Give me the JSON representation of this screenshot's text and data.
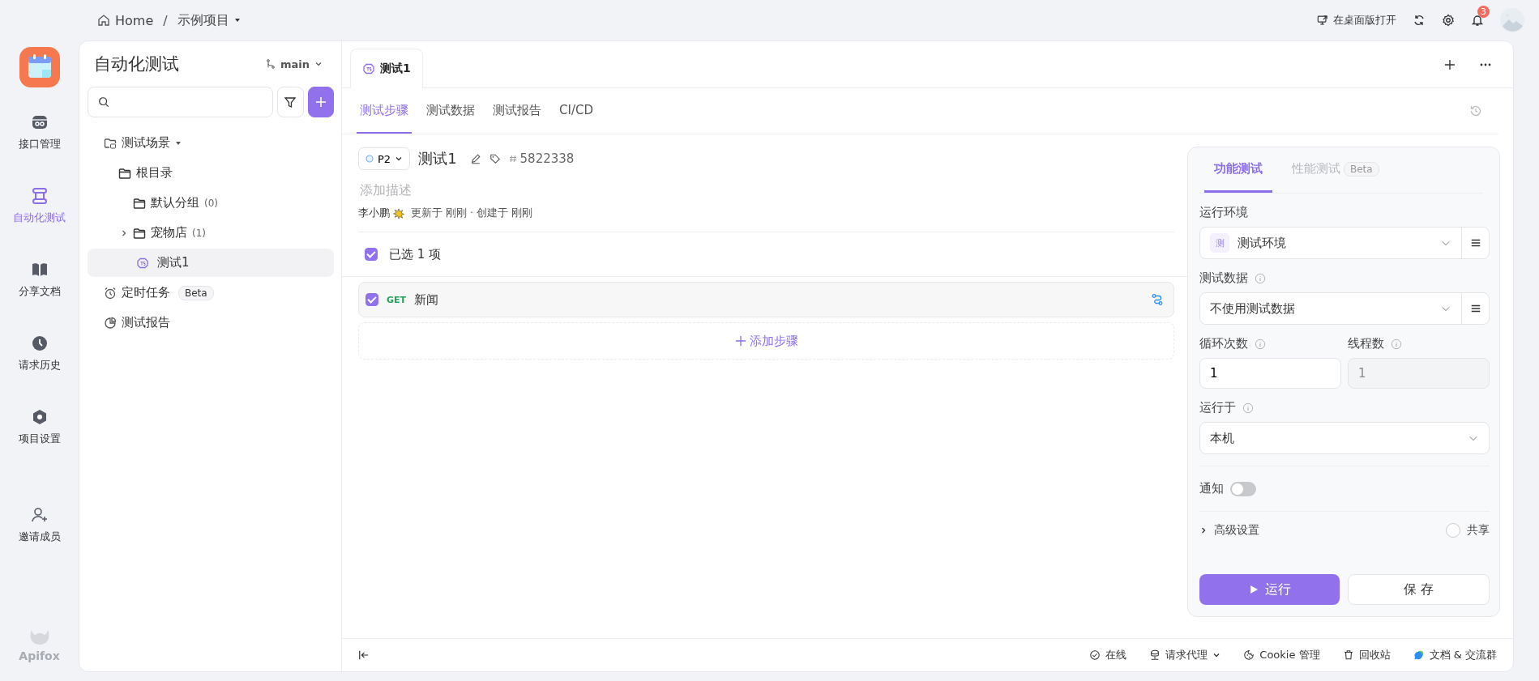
{
  "breadcrumb": {
    "home": "Home",
    "separator": "/",
    "project": "示例项目"
  },
  "toolbar": {
    "open_desktop": "在桌面版打开",
    "notifications": "3"
  },
  "rail": {
    "items": [
      {
        "label": "接口管理",
        "kind": "api",
        "selected": false
      },
      {
        "label": "自动化测试",
        "kind": "auto",
        "selected": true
      },
      {
        "label": "分享文档",
        "kind": "book",
        "selected": false
      },
      {
        "label": "请求历史",
        "kind": "clock",
        "selected": false
      },
      {
        "label": "项目设置",
        "kind": "hex",
        "selected": false
      }
    ],
    "invite": "邀请成员",
    "brand": "Apifox"
  },
  "sidebar": {
    "title": "自动化测试",
    "branch": "main",
    "tree": [
      {
        "label": "测试场景",
        "kind": "scenes",
        "expanded": true,
        "selected": false,
        "children": [
          {
            "label": "根目录",
            "kind": "folder",
            "selected": false,
            "children": [
              {
                "label": "默认分组",
                "count": "(0)",
                "kind": "folder",
                "selected": false
              },
              {
                "label": "宠物店",
                "count": "(1)",
                "kind": "folder",
                "expanded": false,
                "selected": false
              },
              {
                "label": "测试1",
                "kind": "test",
                "selected": true
              }
            ]
          }
        ]
      },
      {
        "label": "定时任务",
        "badge": "Beta",
        "kind": "alarm",
        "selected": false
      },
      {
        "label": "测试报告",
        "kind": "report",
        "selected": false
      }
    ]
  },
  "tabs": [
    {
      "label": "测试1",
      "selected": true
    }
  ],
  "subtabs": [
    {
      "label": "测试步骤",
      "selected": true
    },
    {
      "label": "测试数据",
      "selected": false
    },
    {
      "label": "测试报告",
      "selected": false
    },
    {
      "label": "CI/CD",
      "selected": false
    }
  ],
  "scenario": {
    "priority": "P2",
    "name": "测试1",
    "id": "5822338",
    "description_placeholder": "添加描述",
    "author": "李小鹏",
    "meta": "更新于 刚刚 · 创建于 刚刚"
  },
  "selection": {
    "label": "已选 1 项",
    "checked": true
  },
  "steps": [
    {
      "method": "GET",
      "name": "新闻",
      "checked": true
    }
  ],
  "add_step": "添加步骤",
  "run_panel": {
    "tabs": [
      {
        "label": "功能测试",
        "selected": true
      },
      {
        "label": "性能测试",
        "badge": "Beta",
        "selected": false
      }
    ],
    "env_label": "运行环境",
    "env_badge": "测",
    "env_value": "测试环境",
    "data_label": "测试数据",
    "data_value": "不使用测试数据",
    "loops_label": "循环次数",
    "loops_value": "1",
    "threads_label": "线程数",
    "threads_placeholder": "1",
    "threads_disabled": true,
    "run_on_label": "运行于",
    "run_on_value": "本机",
    "notify_label": "通知",
    "notify_on": false,
    "advanced": "高级设置",
    "share_label": "共享",
    "share_checked": false,
    "run_button": "运行",
    "save_button": "保 存"
  },
  "status_bar": [
    {
      "label": "在线",
      "kind": "online"
    },
    {
      "label": "请求代理",
      "kind": "proxy"
    },
    {
      "label": "Cookie 管理",
      "kind": "cookie"
    },
    {
      "label": "回收站",
      "kind": "trash"
    },
    {
      "label": "文档 & 交流群",
      "kind": "chat"
    }
  ]
}
